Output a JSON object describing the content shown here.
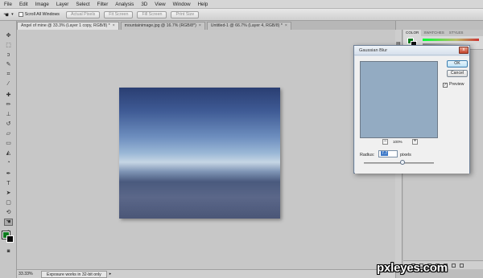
{
  "menu": [
    "File",
    "Edit",
    "Image",
    "Layer",
    "Select",
    "Filter",
    "Analysis",
    "3D",
    "View",
    "Window",
    "Help"
  ],
  "options": {
    "scroll_all_windows": "Scroll All Windows",
    "buttons": [
      "Actual Pixels",
      "Fit Screen",
      "Fill Screen",
      "Print Size"
    ]
  },
  "tabs": [
    {
      "label": "Angel of mine @ 33.3% (Layer 1 copy, RGB/8) *",
      "active": true
    },
    {
      "label": "mountainimage.jpg @ 16.7% (RGB/8*)",
      "active": false
    },
    {
      "label": "Untitled-1 @ 66.7% (Layer 4, RGB/8) *",
      "active": false
    }
  ],
  "status": {
    "zoom": "33.33%",
    "message": "Exposure works in 32-bit only"
  },
  "panel": {
    "tabs": [
      "COLOR",
      "SWATCHES",
      "STYLES"
    ]
  },
  "colors": {
    "foreground": "#0d7a1e",
    "background": "#111111"
  },
  "dialog": {
    "title": "Gaussian Blur",
    "close": "x",
    "ok": "OK",
    "cancel": "Cancel",
    "preview_label": "Preview",
    "preview_checked": "✓",
    "zoom_percent": "100%",
    "zoom_out": "−",
    "zoom_in": "+",
    "radius_label": "Radius:",
    "radius_value": "7.7",
    "radius_unit": "pixels"
  },
  "watermark": "pxleyes.com"
}
